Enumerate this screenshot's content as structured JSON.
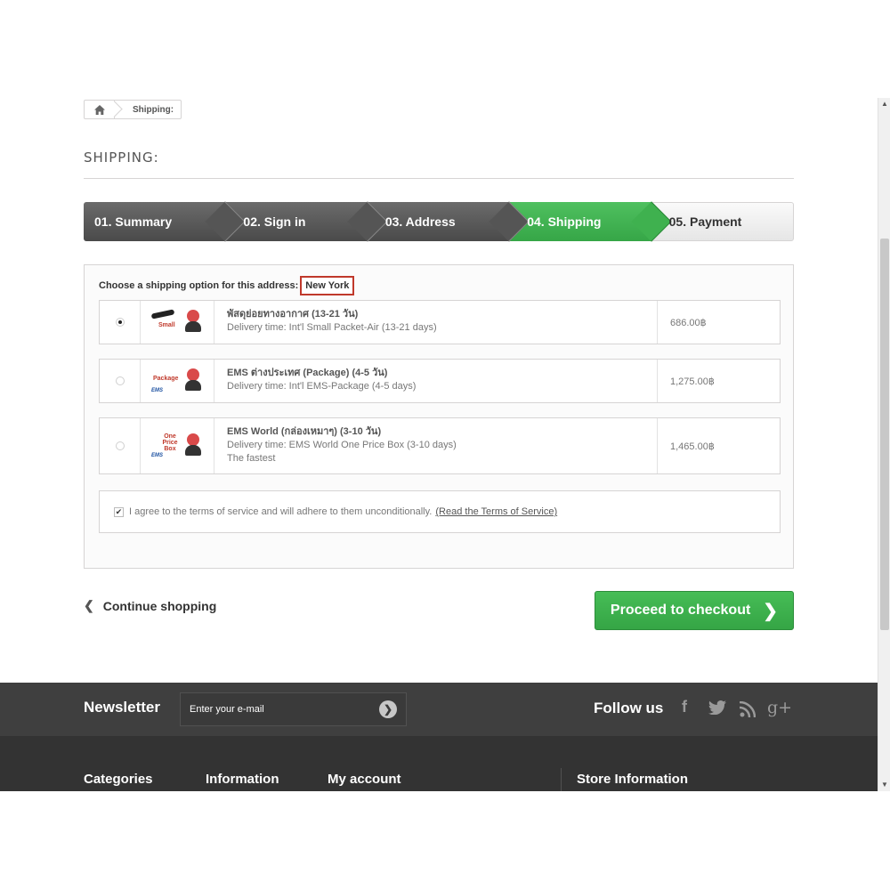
{
  "breadcrumb": {
    "home_icon": "home-icon",
    "current": "Shipping:"
  },
  "page": {
    "heading": "SHIPPING:"
  },
  "steps": [
    {
      "label": "01. Summary",
      "state": "done"
    },
    {
      "label": "02. Sign in",
      "state": "done"
    },
    {
      "label": "03. Address",
      "state": "done"
    },
    {
      "label": "04. Shipping",
      "state": "current"
    },
    {
      "label": "05. Payment",
      "state": "todo"
    }
  ],
  "shipping": {
    "choose_label": "Choose a shipping option for this address:",
    "address": "New York",
    "carriers": [
      {
        "selected": true,
        "logo_words": "Small",
        "name": "พัสดุย่อยทางอากาศ (13-21 วัน)",
        "delivery": "Delivery time: Int'l Small Packet-Air (13-21 days)",
        "extra": "",
        "price": "686.00฿"
      },
      {
        "selected": false,
        "logo_words": "Package",
        "name": "EMS ต่างประเทศ (Package) (4-5 วัน)",
        "delivery": "Delivery time: Int'l EMS-Package (4-5 days)",
        "extra": "",
        "price": "1,275.00฿"
      },
      {
        "selected": false,
        "logo_words": "One Price Box",
        "name": "EMS World (กล่องเหมาๆ) (3-10 วัน)",
        "delivery": "Delivery time: EMS World One Price Box (3-10 days)",
        "extra": "The fastest",
        "price": "1,465.00฿"
      }
    ],
    "terms_text": "I agree to the terms of service and will adhere to them unconditionally.",
    "terms_link": "(Read the Terms of Service)",
    "terms_checked": true
  },
  "actions": {
    "continue": "Continue shopping",
    "checkout": "Proceed to checkout"
  },
  "footer": {
    "newsletter_title": "Newsletter",
    "newsletter_placeholder": "Enter your e-mail",
    "follow_title": "Follow us",
    "social_icons": [
      "facebook-icon",
      "twitter-icon",
      "rss-icon",
      "google-plus-icon"
    ],
    "columns": [
      "Categories",
      "Information",
      "My account",
      "Store Information"
    ]
  },
  "colors": {
    "accent_green": "#3fb14f",
    "dark_step": "#555555",
    "footer_dark": "#333333",
    "highlight_red": "#c0392b"
  }
}
